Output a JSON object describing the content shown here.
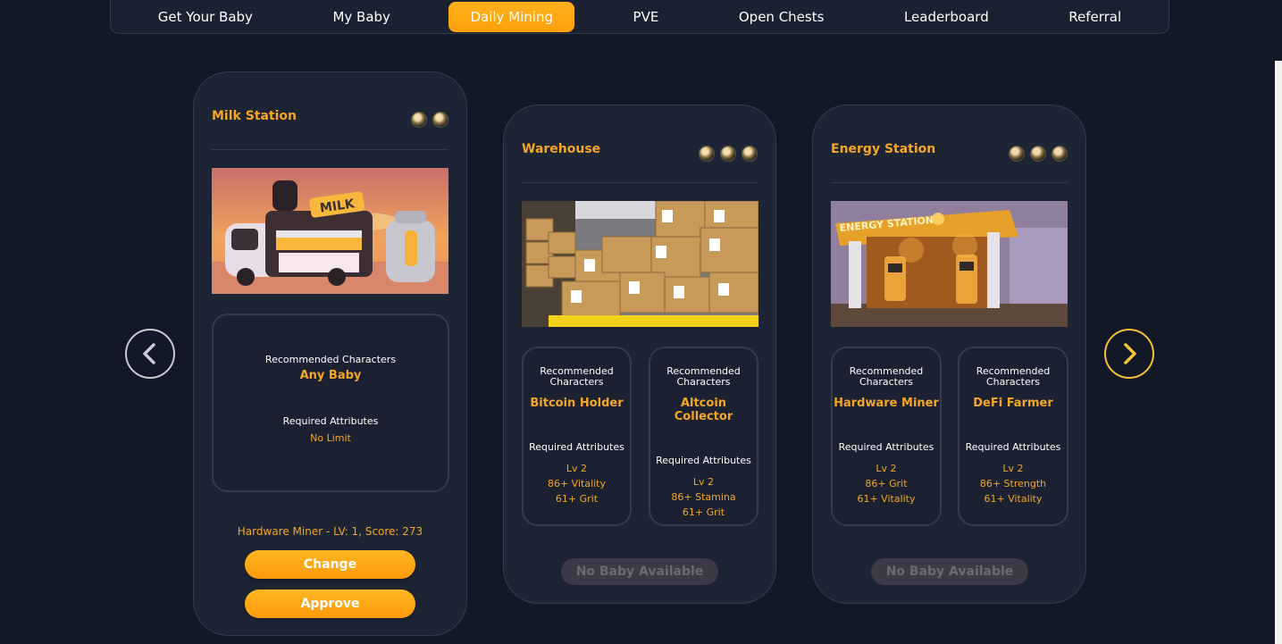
{
  "nav": {
    "tabs": [
      {
        "label": "Get Your Baby"
      },
      {
        "label": "My Baby"
      },
      {
        "label": "Daily Mining"
      },
      {
        "label": "PVE"
      },
      {
        "label": "Open Chests"
      },
      {
        "label": "Leaderboard"
      },
      {
        "label": "Referral"
      }
    ],
    "active": "Daily Mining"
  },
  "colors": {
    "accent": "#f5a623",
    "background": "#121826",
    "card": "#1d2433",
    "arrow_right": "#f5c237",
    "disabled": "#3b3a46"
  },
  "icons": {
    "prev": "chevron-left-icon",
    "next": "chevron-right-icon",
    "coin": "coin-icon"
  },
  "cards": [
    {
      "title": "Milk Station",
      "coins": 2,
      "scene": "milk-truck-scene",
      "scene_text": "MILK",
      "recommended_label": "Recommended Characters",
      "recommended": [
        "Any Baby"
      ],
      "required_label": "Required Attributes",
      "required": [
        "No Limit"
      ],
      "status": "Hardware Miner - LV: 1, Score: 273",
      "change_label": "Change",
      "approve_label": "Approve"
    },
    {
      "title": "Warehouse",
      "coins": 3,
      "scene": "warehouse-boxes-scene",
      "slots": [
        {
          "recommended_label": "Recommended Characters",
          "character": "Bitcoin Holder",
          "required_label": "Required Attributes",
          "attributes": [
            "Lv 2",
            "86+ Vitality",
            "61+ Grit"
          ]
        },
        {
          "recommended_label": "Recommended Characters",
          "character": "Altcoin Collector",
          "required_label": "Required Attributes",
          "attributes": [
            "Lv 2",
            "86+ Stamina",
            "61+ Grit"
          ]
        }
      ],
      "button_label": "No Baby Available"
    },
    {
      "title": "Energy Station",
      "coins": 3,
      "scene": "energy-station-scene",
      "scene_text": "ENERGY STATION",
      "slots": [
        {
          "recommended_label": "Recommended Characters",
          "character": "Hardware Miner",
          "required_label": "Required Attributes",
          "attributes": [
            "Lv 2",
            "86+ Grit",
            "61+ Vitality"
          ]
        },
        {
          "recommended_label": "Recommended Characters",
          "character": "DeFi Farmer",
          "required_label": "Required Attributes",
          "attributes": [
            "Lv 2",
            "86+ Strength",
            "61+ Vitality"
          ]
        }
      ],
      "button_label": "No Baby Available"
    }
  ]
}
